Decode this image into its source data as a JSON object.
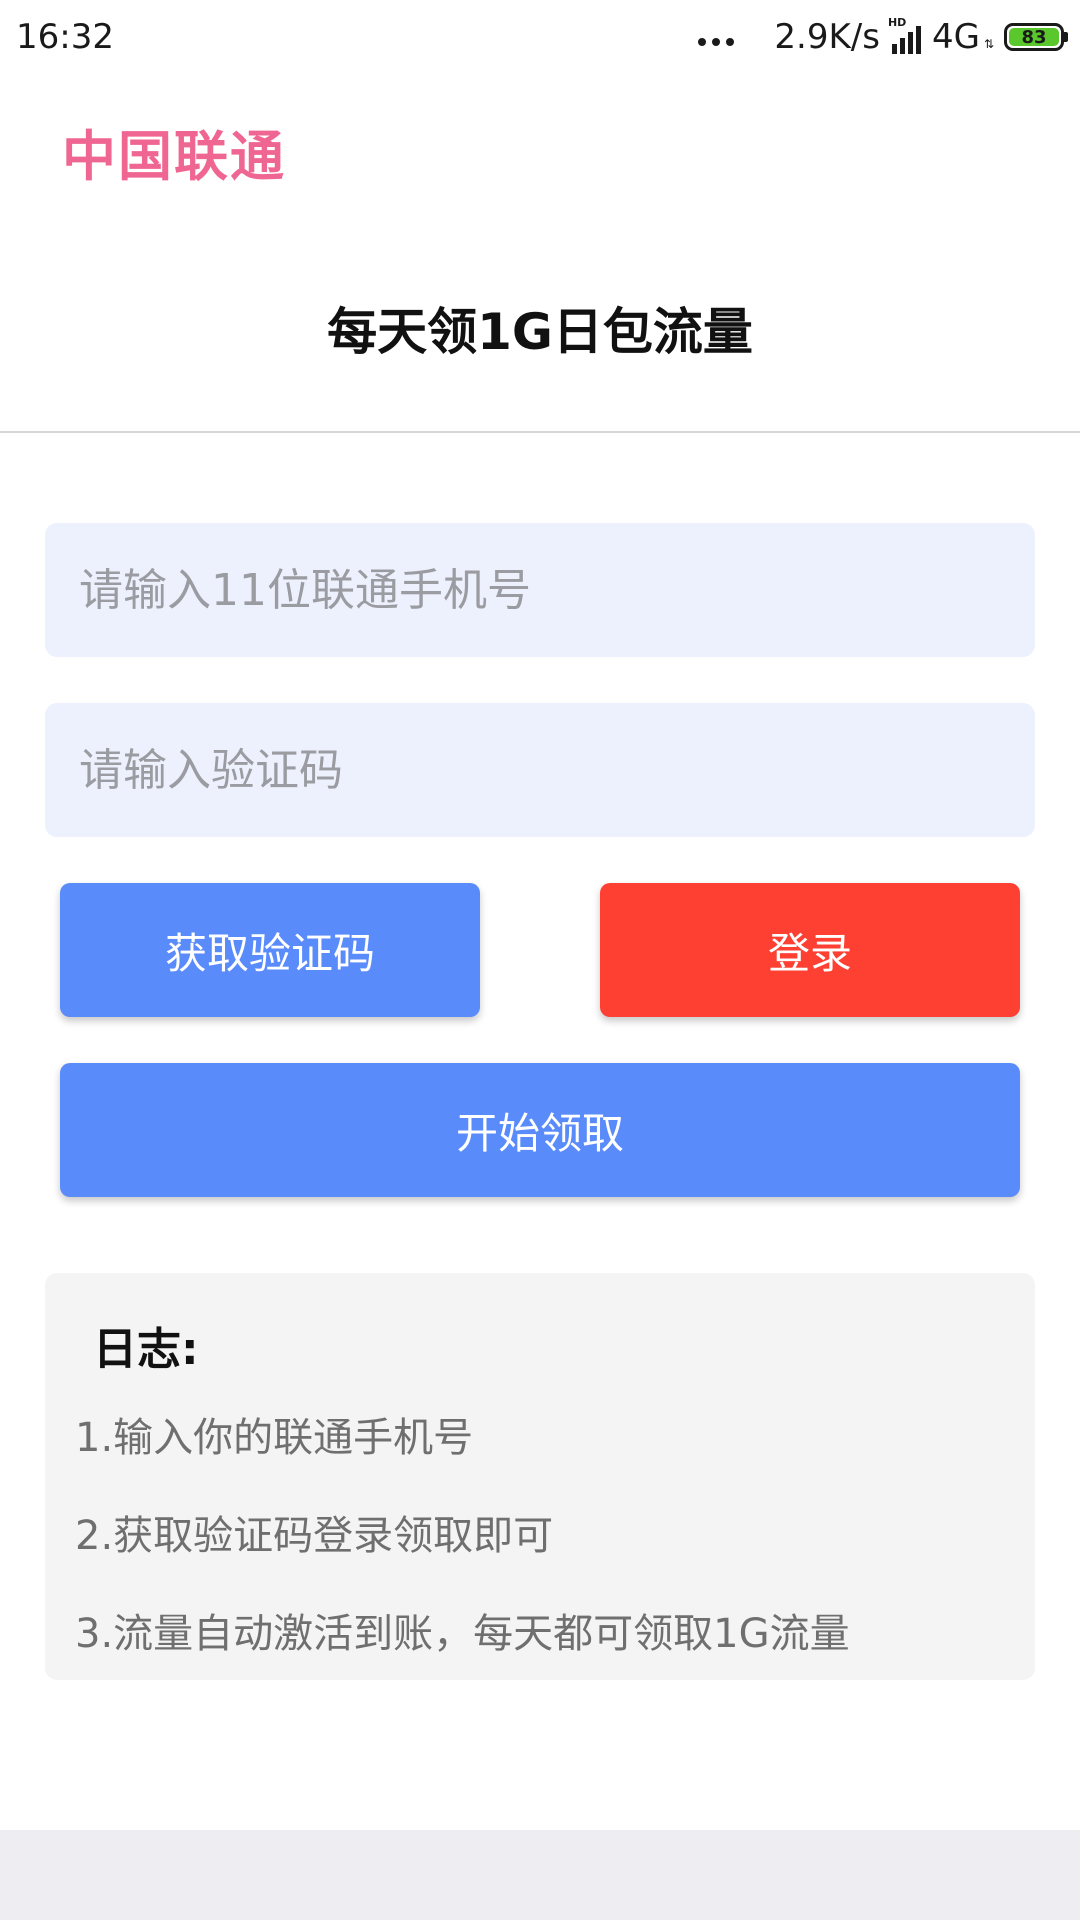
{
  "status_bar": {
    "time": "16:32",
    "net_speed": "2.9K/s",
    "hd_label": "HD",
    "network_type": "4G",
    "battery_level": "83",
    "battery_color": "#5ac72d"
  },
  "header": {
    "brand": "中国联通",
    "brand_color": "#f06693",
    "title": "每天领1G日包流量"
  },
  "form": {
    "phone_placeholder": "请输入11位联通手机号",
    "phone_value": "",
    "code_placeholder": "请输入验证码",
    "code_value": ""
  },
  "buttons": {
    "get_code_label": "获取验证码",
    "login_label": "登录",
    "start_label": "开始领取",
    "primary_color": "#5a8bfb",
    "login_color": "#fe4033"
  },
  "log": {
    "title": "日志:",
    "items": [
      "1.输入你的联通手机号",
      "2.获取验证码登录领取即可",
      "3.流量自动激活到账，每天都可领取1G流量"
    ]
  }
}
